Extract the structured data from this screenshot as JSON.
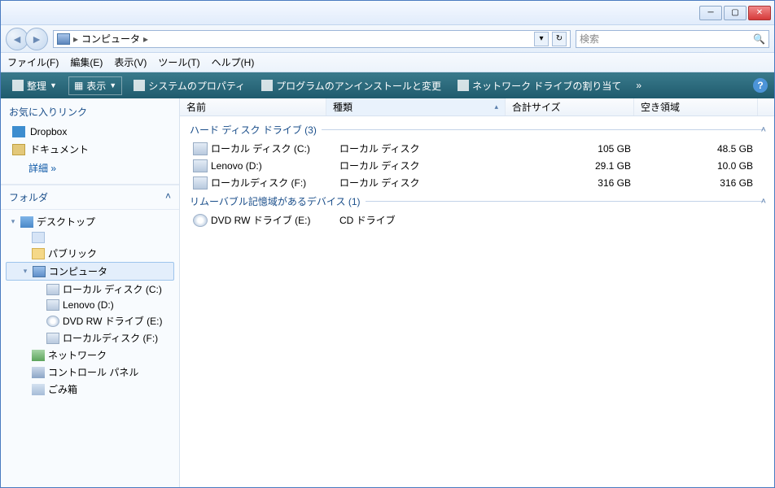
{
  "titlebar": {},
  "nav": {
    "address_icon": "computer",
    "address_text": "コンピュータ",
    "search_placeholder": "検索"
  },
  "menubar": {
    "file": "ファイル(F)",
    "edit": "編集(E)",
    "view": "表示(V)",
    "tools": "ツール(T)",
    "help": "ヘルプ(H)"
  },
  "cmdbar": {
    "organize": "整理",
    "views": "表示",
    "sysprops": "システムのプロパティ",
    "programs": "プログラムのアンインストールと変更",
    "mapdrive": "ネットワーク ドライブの割り当て",
    "more": "»"
  },
  "sidebar": {
    "fav_title": "お気に入りリンク",
    "dropbox": "Dropbox",
    "documents": "ドキュメント",
    "detail": "詳細  »",
    "folders_title": "フォルダ",
    "tree": {
      "desktop": "デスクトップ",
      "user": "",
      "public": "パブリック",
      "computer": "コンピュータ",
      "disk_c": "ローカル ディスク (C:)",
      "disk_d": "Lenovo (D:)",
      "dvd_e": "DVD RW ドライブ (E:)",
      "disk_f": "ローカルディスク (F:)",
      "network": "ネットワーク",
      "cpanel": "コントロール パネル",
      "trash": "ごみ箱"
    }
  },
  "columns": {
    "name": "名前",
    "type": "種類",
    "size": "合計サイズ",
    "free": "空き領域"
  },
  "groups": {
    "hdd": "ハード ディスク ドライブ (3)",
    "removable": "リムーバブル記憶域があるデバイス (1)"
  },
  "drives": [
    {
      "name": "ローカル ディスク (C:)",
      "type": "ローカル ディスク",
      "size": "105 GB",
      "free": "48.5 GB",
      "icon": "disk"
    },
    {
      "name": "Lenovo (D:)",
      "type": "ローカル ディスク",
      "size": "29.1 GB",
      "free": "10.0 GB",
      "icon": "disk"
    },
    {
      "name": "ローカルディスク (F:)",
      "type": "ローカル ディスク",
      "size": "316 GB",
      "free": "316 GB",
      "icon": "disk"
    }
  ],
  "removable": [
    {
      "name": "DVD RW ドライブ (E:)",
      "type": "CD ドライブ",
      "size": "",
      "free": "",
      "icon": "dvd"
    }
  ]
}
